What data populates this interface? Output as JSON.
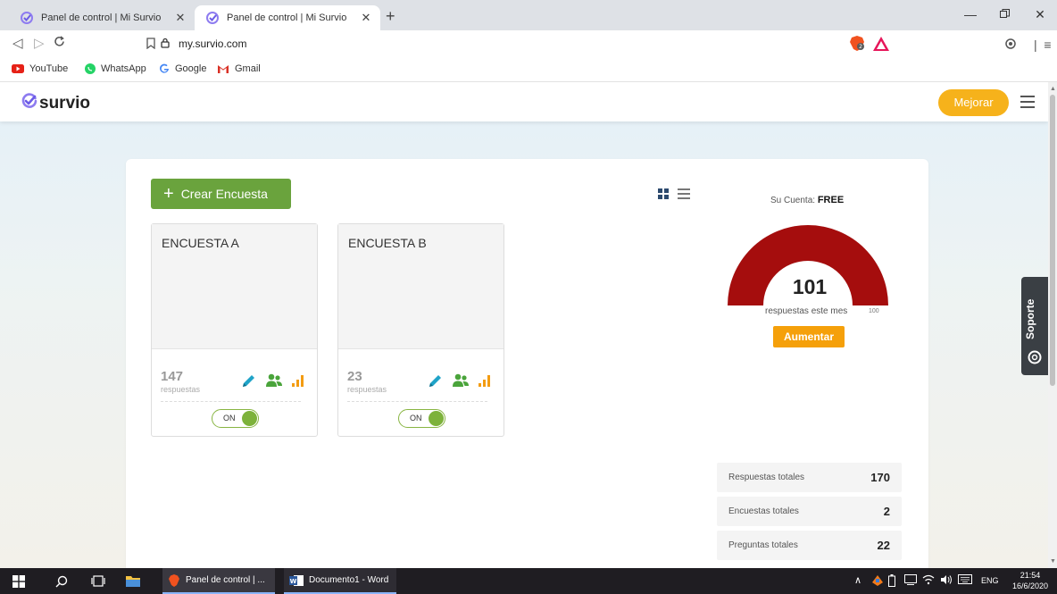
{
  "browser": {
    "tabs": [
      {
        "title": "Panel de control | Mi Survio",
        "active": false
      },
      {
        "title": "Panel de control | Mi Survio",
        "active": true
      }
    ],
    "new_tab_label": "+",
    "url": "my.survio.com",
    "bookmarks": [
      {
        "label": "YouTube"
      },
      {
        "label": "WhatsApp"
      },
      {
        "label": "Google"
      },
      {
        "label": "Gmail"
      }
    ]
  },
  "app": {
    "logo_text": "survio",
    "upgrade_label": "Mejorar",
    "create_label": "Crear Encuesta",
    "surveys": [
      {
        "name": "ENCUESTA A",
        "responses": "147",
        "responses_label": "respuestas",
        "toggle": "ON"
      },
      {
        "name": "ENCUESTA B",
        "responses": "23",
        "responses_label": "respuestas",
        "toggle": "ON"
      }
    ],
    "account": {
      "label": "Su Cuenta:",
      "plan": "FREE",
      "gauge_value": "101",
      "gauge_label": "respuestas este mes",
      "gauge_max": "100",
      "gauge_fraction": 1.0,
      "increase_label": "Aumentar"
    },
    "stats": [
      {
        "label": "Respuestas totales",
        "value": "170"
      },
      {
        "label": "Encuestas totales",
        "value": "2"
      },
      {
        "label": "Preguntas totales",
        "value": "22"
      }
    ],
    "support_label": "Soporte"
  },
  "taskbar": {
    "apps": [
      {
        "label": "Panel de control | ..."
      },
      {
        "label": "Documento1 - Word"
      }
    ],
    "language": "ENG",
    "time": "21:54",
    "date": "16/6/2020"
  },
  "colors": {
    "brand_purple": "#6c5ce7",
    "upgrade_yellow": "#f6b21b",
    "create_green": "#6aa33d",
    "gauge_red": "#a50d0d",
    "increase_orange": "#f5a00a"
  }
}
